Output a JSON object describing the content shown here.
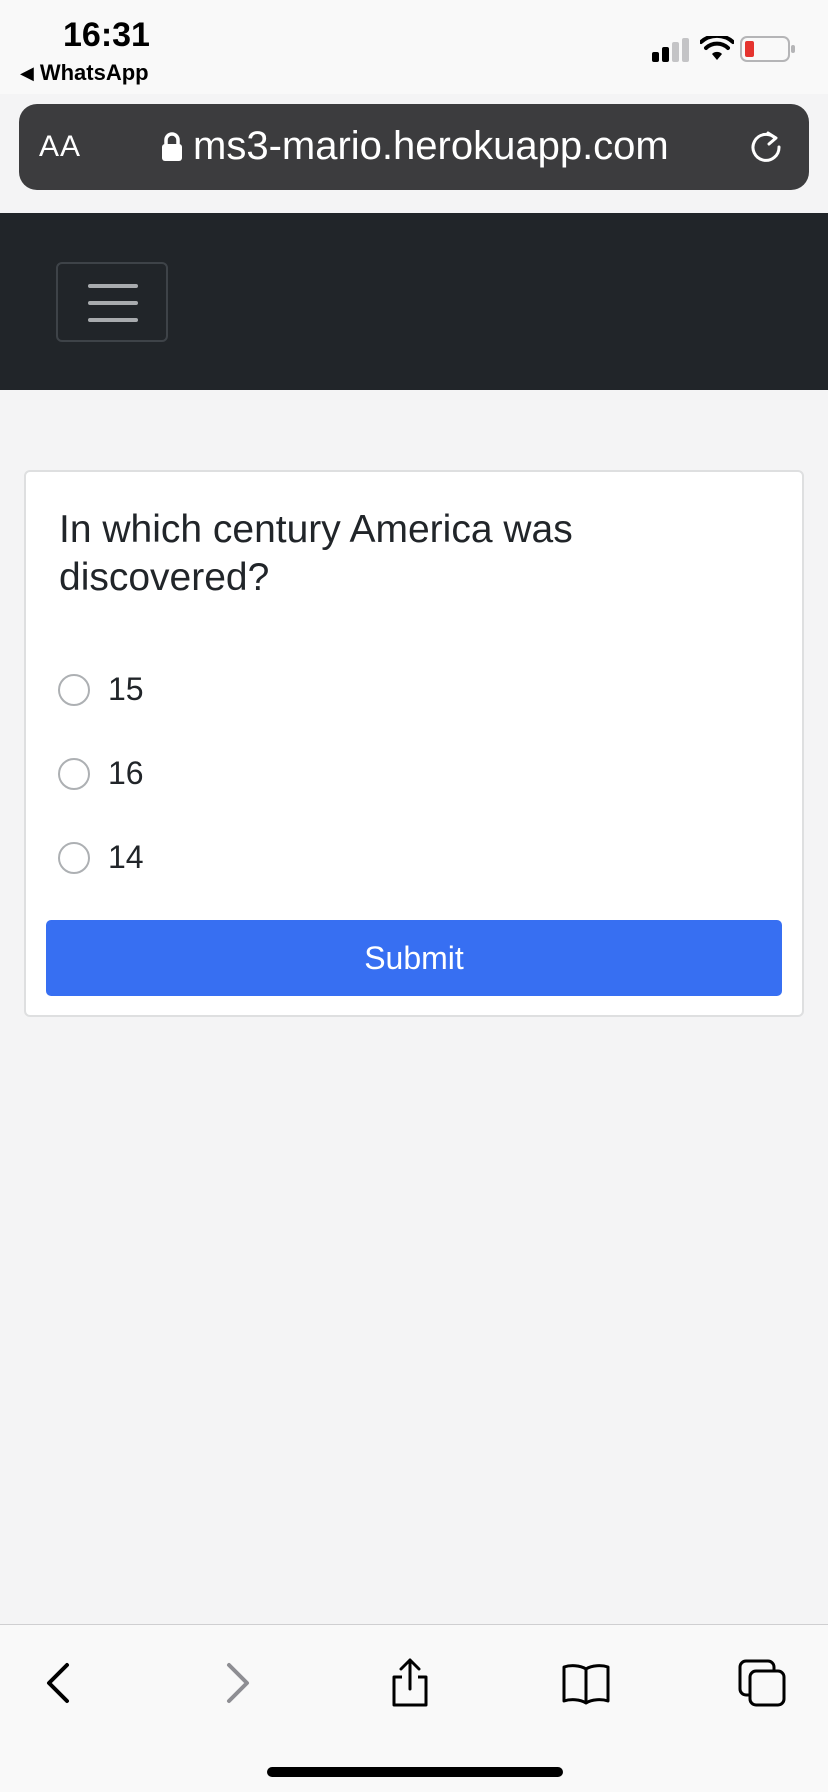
{
  "status_bar": {
    "time": "16:31",
    "back_app": "WhatsApp"
  },
  "browser": {
    "aa_label": "AA",
    "url": "ms3-mario.herokuapp.com"
  },
  "quiz": {
    "question": "In which century America was discovered?",
    "options": [
      "15",
      "16",
      "14"
    ],
    "submit_label": "Submit"
  },
  "colors": {
    "navbar": "#212529",
    "submit_button": "#376ff2",
    "url_bar": "#3c3c3e"
  }
}
